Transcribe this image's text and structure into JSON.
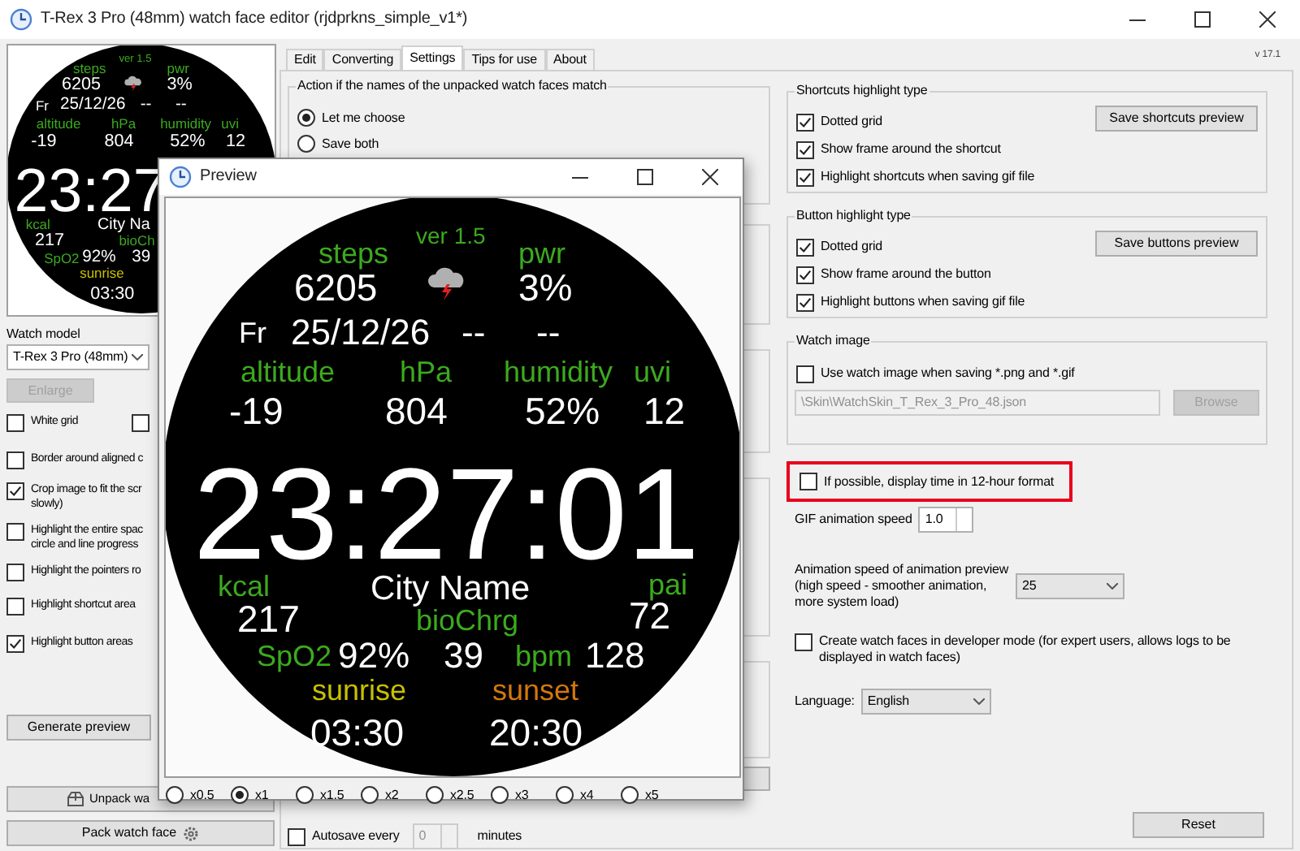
{
  "window": {
    "title": "T-Rex 3 Pro (48mm) watch face editor (rjdprkns_simple_v1*)"
  },
  "thumbnail": {
    "items": [
      {
        "text": "ver 1.5",
        "color": "#3caa1e"
      },
      {
        "text": "steps",
        "color": "#3caa1e"
      },
      {
        "text": "pwr",
        "color": "#3caa1e"
      },
      {
        "text": "6205",
        "color": "#ffffff"
      },
      {
        "text": "3%",
        "color": "#ffffff"
      },
      {
        "text": "Fr",
        "color": "#ffffff"
      },
      {
        "text": "25/12/26",
        "color": "#ffffff"
      },
      {
        "text": "--",
        "color": "#ffffff"
      },
      {
        "text": "--",
        "color": "#ffffff"
      },
      {
        "text": "altitude",
        "color": "#3caa1e"
      },
      {
        "text": "hPa",
        "color": "#3caa1e"
      },
      {
        "text": "humidity",
        "color": "#3caa1e"
      },
      {
        "text": "uvi",
        "color": "#3caa1e"
      },
      {
        "text": "-19",
        "color": "#ffffff"
      },
      {
        "text": "804",
        "color": "#ffffff"
      },
      {
        "text": "52%",
        "color": "#ffffff"
      },
      {
        "text": "12",
        "color": "#ffffff"
      },
      {
        "text": "23:27",
        "color": "#ffffff"
      },
      {
        "text": "kcal",
        "color": "#3caa1e"
      },
      {
        "text": "City Na",
        "color": "#ffffff"
      },
      {
        "text": "217",
        "color": "#ffffff"
      },
      {
        "text": "bioCh",
        "color": "#3caa1e"
      },
      {
        "text": "SpO2",
        "color": "#3caa1e"
      },
      {
        "text": "92%",
        "color": "#ffffff"
      },
      {
        "text": "39",
        "color": "#ffffff"
      },
      {
        "text": "sunrise",
        "color": "#c8c000"
      },
      {
        "text": "03:30",
        "color": "#ffffff"
      }
    ]
  },
  "watch_model": {
    "label": "Watch model",
    "value": "T-Rex 3 Pro (48mm)"
  },
  "enlarge_button": {
    "label": "Enlarge",
    "disabled": true
  },
  "white_grid": {
    "label": "White grid",
    "checked": false
  },
  "second_grid_option": {
    "checked": false
  },
  "left_options": [
    {
      "label": "Border around aligned c",
      "checked": false
    },
    {
      "label": "Crop image to fit the scr\nslowly)",
      "checked": true
    },
    {
      "label": "Highlight the entire spac\ncircle and line progress",
      "checked": false
    },
    {
      "label": "Highlight the pointers ro",
      "checked": false
    },
    {
      "label": "Highlight shortcut area",
      "checked": false
    },
    {
      "label": "Highlight button areas",
      "checked": true
    }
  ],
  "generate_button": "Generate preview",
  "unpack_button": "Unpack wa",
  "pack_button": "Pack watch face",
  "tabs": [
    {
      "label": "Edit",
      "selected": false
    },
    {
      "label": "Converting",
      "selected": false
    },
    {
      "label": "Settings",
      "selected": true
    },
    {
      "label": "Tips for use",
      "selected": false
    },
    {
      "label": "About",
      "selected": false
    }
  ],
  "version": "v 17.1",
  "name_conflict": {
    "title": "Action if the names of the unpacked watch faces match",
    "options": [
      {
        "label": "Let me choose",
        "selected": true
      },
      {
        "label": "Save both",
        "selected": false
      }
    ]
  },
  "autosave": {
    "label": "Autosave every",
    "checked": false,
    "value": "0",
    "disabled": true,
    "unit": "minutes"
  },
  "shortcuts_group": {
    "title": "Shortcuts highlight type",
    "options": [
      {
        "label": "Dotted grid",
        "checked": true
      },
      {
        "label": "Show frame around the shortcut",
        "checked": true
      },
      {
        "label": "Highlight shortcuts when saving gif file",
        "checked": true
      }
    ],
    "button": "Save shortcuts preview"
  },
  "buttons_group": {
    "title": "Button highlight type",
    "options": [
      {
        "label": "Dotted grid",
        "checked": true
      },
      {
        "label": "Show frame around the button",
        "checked": true
      },
      {
        "label": "Highlight buttons when saving gif file",
        "checked": true
      }
    ],
    "button": "Save buttons preview"
  },
  "watch_image": {
    "title": "Watch image",
    "option": {
      "label": "Use watch image when saving *.png and *.gif",
      "checked": false
    },
    "path": "\\Skin\\WatchSkin_T_Rex_3_Pro_48.json",
    "disabled": true,
    "browse": "Browse"
  },
  "twelve_hour": {
    "label": "If possible, display time in 12-hour format",
    "checked": false
  },
  "gif_speed": {
    "label": "GIF animation speed",
    "value": "1.0"
  },
  "preview_speed": {
    "label": "Animation speed of animation preview\n(high speed - smoother animation,\nmore system load)",
    "value": "25"
  },
  "developer_mode": {
    "label": "Create watch faces in developer mode (for expert users, allows logs to be displayed in watch faces)",
    "checked": false
  },
  "language": {
    "label": "Language:",
    "value": "English"
  },
  "reset_button": "Reset",
  "preview": {
    "title": "Preview",
    "items": [
      {
        "text": "ver 1.5",
        "color": "#3caa1e"
      },
      {
        "text": "steps",
        "color": "#3caa1e"
      },
      {
        "text": "pwr",
        "color": "#3caa1e"
      },
      {
        "text": "6205",
        "color": "#ffffff"
      },
      {
        "text": "3%",
        "color": "#ffffff"
      },
      {
        "text": "Fr",
        "color": "#ffffff"
      },
      {
        "text": "25/12/26",
        "color": "#ffffff"
      },
      {
        "text": "--",
        "color": "#ffffff"
      },
      {
        "text": "--",
        "color": "#ffffff"
      },
      {
        "text": "altitude",
        "color": "#3caa1e"
      },
      {
        "text": "hPa",
        "color": "#3caa1e"
      },
      {
        "text": "humidity",
        "color": "#3caa1e"
      },
      {
        "text": "uvi",
        "color": "#3caa1e"
      },
      {
        "text": "-19",
        "color": "#ffffff"
      },
      {
        "text": "804",
        "color": "#ffffff"
      },
      {
        "text": "52%",
        "color": "#ffffff"
      },
      {
        "text": "12",
        "color": "#ffffff"
      },
      {
        "text": "23:27:01",
        "color": "#ffffff"
      },
      {
        "text": "kcal",
        "color": "#3caa1e"
      },
      {
        "text": "City Name",
        "color": "#ffffff"
      },
      {
        "text": "pai",
        "color": "#3caa1e"
      },
      {
        "text": "217",
        "color": "#ffffff"
      },
      {
        "text": "bioChrg",
        "color": "#3caa1e"
      },
      {
        "text": "72",
        "color": "#ffffff"
      },
      {
        "text": "SpO2",
        "color": "#3caa1e"
      },
      {
        "text": "92%",
        "color": "#ffffff"
      },
      {
        "text": "39",
        "color": "#ffffff"
      },
      {
        "text": "bpm",
        "color": "#3caa1e"
      },
      {
        "text": "128",
        "color": "#ffffff"
      },
      {
        "text": "sunrise",
        "color": "#c8c000"
      },
      {
        "text": "sunset",
        "color": "#d4780a"
      },
      {
        "text": "03:30",
        "color": "#ffffff"
      },
      {
        "text": "20:30",
        "color": "#ffffff"
      }
    ],
    "zoom_options": [
      {
        "label": "x0.5",
        "selected": false
      },
      {
        "label": "x1",
        "selected": true
      },
      {
        "label": "x1.5",
        "selected": false
      },
      {
        "label": "x2",
        "selected": false
      },
      {
        "label": "x2.5",
        "selected": false
      },
      {
        "label": "x3",
        "selected": false
      },
      {
        "label": "x4",
        "selected": false
      },
      {
        "label": "x5",
        "selected": false
      }
    ]
  }
}
